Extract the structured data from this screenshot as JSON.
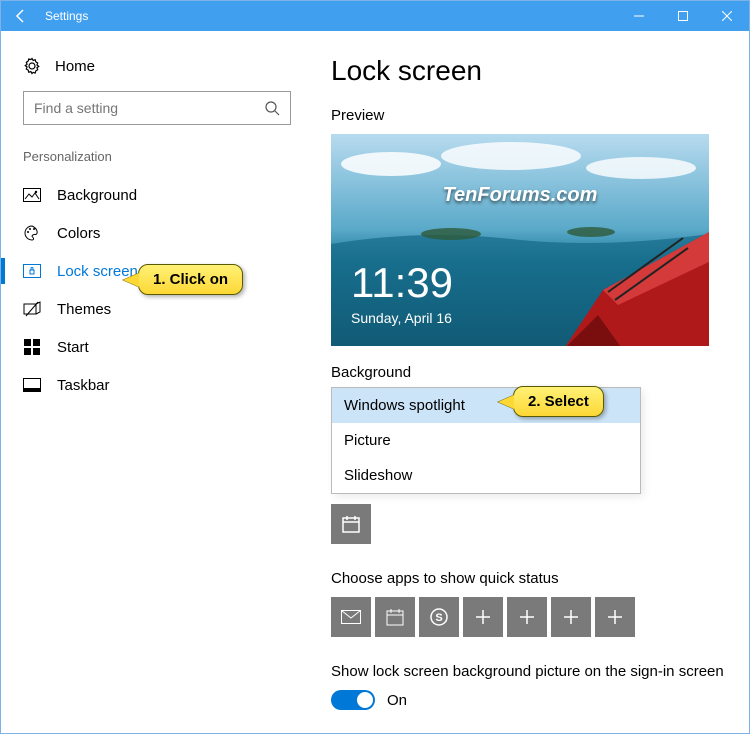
{
  "titlebar": {
    "title": "Settings"
  },
  "sidebar": {
    "home_label": "Home",
    "search_placeholder": "Find a setting",
    "section_label": "Personalization",
    "items": [
      {
        "label": "Background"
      },
      {
        "label": "Colors"
      },
      {
        "label": "Lock screen"
      },
      {
        "label": "Themes"
      },
      {
        "label": "Start"
      },
      {
        "label": "Taskbar"
      }
    ]
  },
  "main": {
    "page_title": "Lock screen",
    "preview_label": "Preview",
    "preview_time": "11:39",
    "preview_date": "Sunday, April 16",
    "watermark": "TenForums.com",
    "background_label": "Background",
    "background_options": [
      "Windows spotlight",
      "Picture",
      "Slideshow"
    ],
    "quick_status_label": "Choose apps to show quick status",
    "signin_toggle_label": "Show lock screen background picture on the sign-in screen",
    "toggle_state": "On"
  },
  "callouts": {
    "c1": "1. Click on",
    "c2": "2. Select"
  }
}
